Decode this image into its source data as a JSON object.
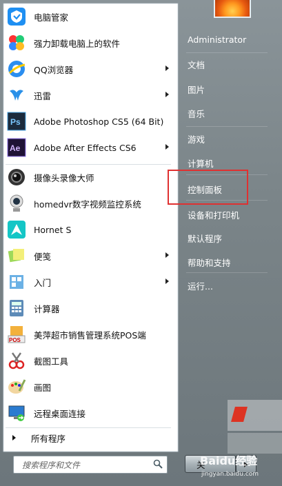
{
  "start_menu": {
    "programs": [
      {
        "label": "电脑管家",
        "icon": "tencent-pc-manager-icon",
        "has_submenu": false
      },
      {
        "label": "强力卸载电脑上的软件",
        "icon": "uninstall-flower-icon",
        "has_submenu": false
      },
      {
        "label": "QQ浏览器",
        "icon": "qq-browser-icon",
        "has_submenu": true
      },
      {
        "label": "迅雷",
        "icon": "thunder-icon",
        "has_submenu": true
      },
      {
        "label": "Adobe Photoshop CS5 (64 Bit)",
        "icon": "photoshop-icon",
        "icon_text": "Ps",
        "has_submenu": false
      },
      {
        "label": "Adobe After Effects CS6",
        "icon": "after-effects-icon",
        "icon_text": "Ae",
        "has_submenu": true
      },
      {
        "label": "摄像头录像大师",
        "icon": "webcam-recorder-icon",
        "has_submenu": false
      },
      {
        "label": "homedvr数字视频监控系统",
        "icon": "webcam-icon",
        "has_submenu": false
      },
      {
        "label": "Hornet S",
        "icon": "hornet-icon",
        "has_submenu": false
      },
      {
        "label": "便笺",
        "icon": "sticky-notes-icon",
        "has_submenu": true
      },
      {
        "label": "入门",
        "icon": "getting-started-icon",
        "has_submenu": true
      },
      {
        "label": "计算器",
        "icon": "calculator-icon",
        "has_submenu": false
      },
      {
        "label": "美萍超市销售管理系统POS端",
        "icon": "pos-terminal-icon",
        "icon_text": "POS",
        "has_submenu": false
      },
      {
        "label": "截图工具",
        "icon": "snipping-tool-icon",
        "has_submenu": false
      },
      {
        "label": "画图",
        "icon": "paint-icon",
        "has_submenu": false
      },
      {
        "label": "远程桌面连接",
        "icon": "remote-desktop-icon",
        "has_submenu": false
      }
    ],
    "all_programs_label": "所有程序",
    "search_placeholder": "搜索程序和文件",
    "right_items": [
      "Administrator",
      "文档",
      "图片",
      "音乐",
      "游戏",
      "计算机",
      "控制面板",
      "设备和打印机",
      "默认程序",
      "帮助和支持",
      "运行..."
    ],
    "shutdown_label": "关",
    "watermark_text": "Baidu经验",
    "watermark_url": "jingyan.baidu.com",
    "highlight_color": "#e03030"
  }
}
